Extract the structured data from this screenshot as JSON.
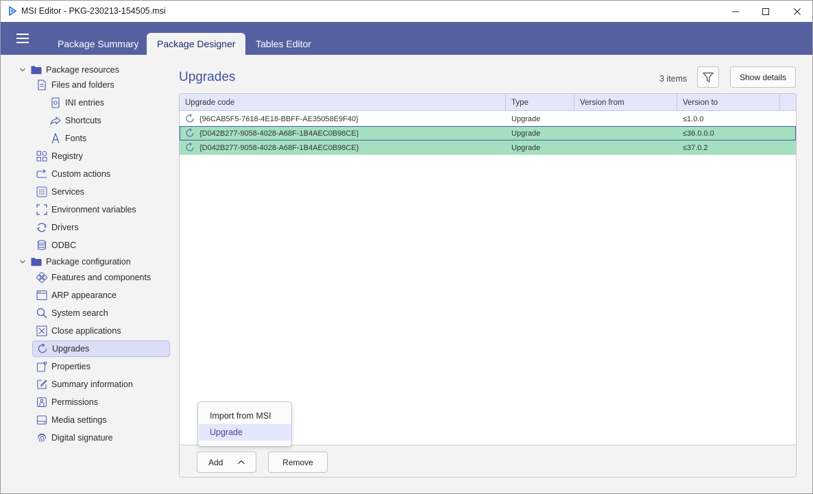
{
  "window": {
    "title": "MSI Editor - PKG-230213-154505.msi"
  },
  "tabs": [
    {
      "label": "Package Summary",
      "active": false
    },
    {
      "label": "Package Designer",
      "active": true
    },
    {
      "label": "Tables Editor",
      "active": false
    }
  ],
  "sidebar": {
    "groups": [
      {
        "label": "Package resources",
        "icon": "folder-icon",
        "expanded": true
      },
      {
        "label": "Package configuration",
        "icon": "folder-icon",
        "expanded": true
      }
    ],
    "items": [
      {
        "label": "Files and folders",
        "icon": "file-icon"
      },
      {
        "label": "INI entries",
        "icon": "ini-file-icon"
      },
      {
        "label": "Shortcuts",
        "icon": "shortcut-icon"
      },
      {
        "label": "Fonts",
        "icon": "font-icon"
      },
      {
        "label": "Registry",
        "icon": "registry-icon"
      },
      {
        "label": "Custom actions",
        "icon": "custom-action-icon"
      },
      {
        "label": "Services",
        "icon": "services-icon"
      },
      {
        "label": "Environment variables",
        "icon": "environment-icon"
      },
      {
        "label": "Drivers",
        "icon": "drivers-icon"
      },
      {
        "label": "ODBC",
        "icon": "database-icon"
      },
      {
        "label": "Features and components",
        "icon": "features-icon"
      },
      {
        "label": "ARP appearance",
        "icon": "window-icon"
      },
      {
        "label": "System search",
        "icon": "search-icon"
      },
      {
        "label": "Close applications",
        "icon": "close-box-icon"
      },
      {
        "label": "Upgrades",
        "icon": "upgrade-icon",
        "selected": true
      },
      {
        "label": "Properties",
        "icon": "properties-icon"
      },
      {
        "label": "Summary information",
        "icon": "edit-icon"
      },
      {
        "label": "Permissions",
        "icon": "lock-icon"
      },
      {
        "label": "Media settings",
        "icon": "media-icon"
      },
      {
        "label": "Digital signature",
        "icon": "fingerprint-icon"
      }
    ]
  },
  "main": {
    "title": "Upgrades",
    "items_count": "3 items",
    "show_details_label": "Show details",
    "columns": [
      "Upgrade code",
      "Type",
      "Version from",
      "Version to"
    ],
    "rows": [
      {
        "code": "{96CAB5F5-7618-4E18-BBFF-AE35058E9F40}",
        "type": "Upgrade",
        "from": "",
        "to": "≤1.0.0",
        "state": "normal"
      },
      {
        "code": "{D042B277-9058-4028-A68F-1B4AEC0B98CE}",
        "type": "Upgrade",
        "from": "",
        "to": "≤36.0.0.0",
        "state": "conflict-focused"
      },
      {
        "code": "{D042B277-9058-4028-A68F-1B4AEC0B98CE}",
        "type": "Upgrade",
        "from": "",
        "to": "≤37.0.2",
        "state": "conflict"
      }
    ],
    "add_label": "Add",
    "remove_label": "Remove",
    "add_menu": {
      "items": [
        "Import from MSI",
        "Upgrade"
      ],
      "highlighted": "Upgrade"
    }
  },
  "colors": {
    "header_band": "#5561a0",
    "accent": "#4150a8",
    "conflict_row": "#a4e0c0",
    "selection": "#dcdef6"
  }
}
